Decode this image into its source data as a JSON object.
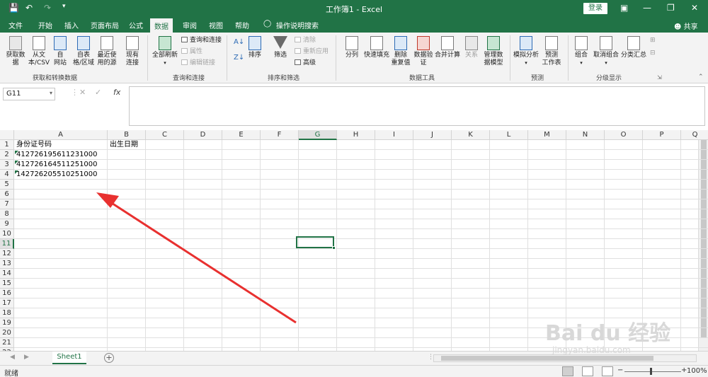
{
  "titlebar": {
    "title": "工作簿1  -  Excel",
    "login": "登录",
    "save_icon": "save-icon",
    "undo_icon": "undo-icon",
    "redo_icon": "redo-icon"
  },
  "tabs": [
    "文件",
    "开始",
    "插入",
    "页面布局",
    "公式",
    "数据",
    "审阅",
    "视图",
    "帮助",
    "操作说明搜索"
  ],
  "active_tab": "数据",
  "share": "共享",
  "ribbon": {
    "get_data": "获取数\n据",
    "from_text": "从文\n本/CSV",
    "from_web": "自\n网站",
    "from_table": "自表\n格/区域",
    "recent_sources": "最近使\n用的源",
    "existing_conn": "现有\n连接",
    "group_get": "获取和转换数据",
    "refresh_all": "全部刷新",
    "queries_conn": "查询和连接",
    "properties": "属性",
    "edit_links": "编辑链接",
    "group_queries": "查询和连接",
    "sort": "排序",
    "filter": "筛选",
    "clear": "清除",
    "reapply": "重新应用",
    "advanced": "高级",
    "group_sort": "排序和筛选",
    "text_to_cols": "分列",
    "flash_fill": "快速填充",
    "remove_dup": "删除\n重复值",
    "data_valid": "数据验\n证",
    "consolidate": "合并计算",
    "relations": "关系",
    "data_model": "管理数\n据模型",
    "group_tools": "数据工具",
    "what_if": "模拟分析",
    "forecast": "预测\n工作表",
    "group_forecast": "预测",
    "group_btn": "组合",
    "ungroup": "取消组合",
    "subtotal": "分类汇总",
    "group_outline": "分级显示"
  },
  "namebox": "G11",
  "columns": [
    "A",
    "B",
    "C",
    "D",
    "E",
    "F",
    "G",
    "H",
    "I",
    "J",
    "K",
    "L",
    "M",
    "N",
    "O",
    "P",
    "Q"
  ],
  "rows": [
    "1",
    "2",
    "3",
    "4",
    "5",
    "6",
    "7",
    "8",
    "9",
    "10",
    "11",
    "12",
    "13",
    "14",
    "15",
    "16",
    "17",
    "18",
    "19",
    "20",
    "21",
    "22"
  ],
  "cells": {
    "A1": "身份证号码",
    "B1": "出生日期",
    "A2": "412726195611231000",
    "A3": "412726164511251000",
    "A4": "142726205510251000"
  },
  "sheet_tab": "Sheet1",
  "status": "就绪",
  "zoom": "100%",
  "watermark": "Bai du 经验",
  "watermark_url": "jingyan.baidu.com"
}
